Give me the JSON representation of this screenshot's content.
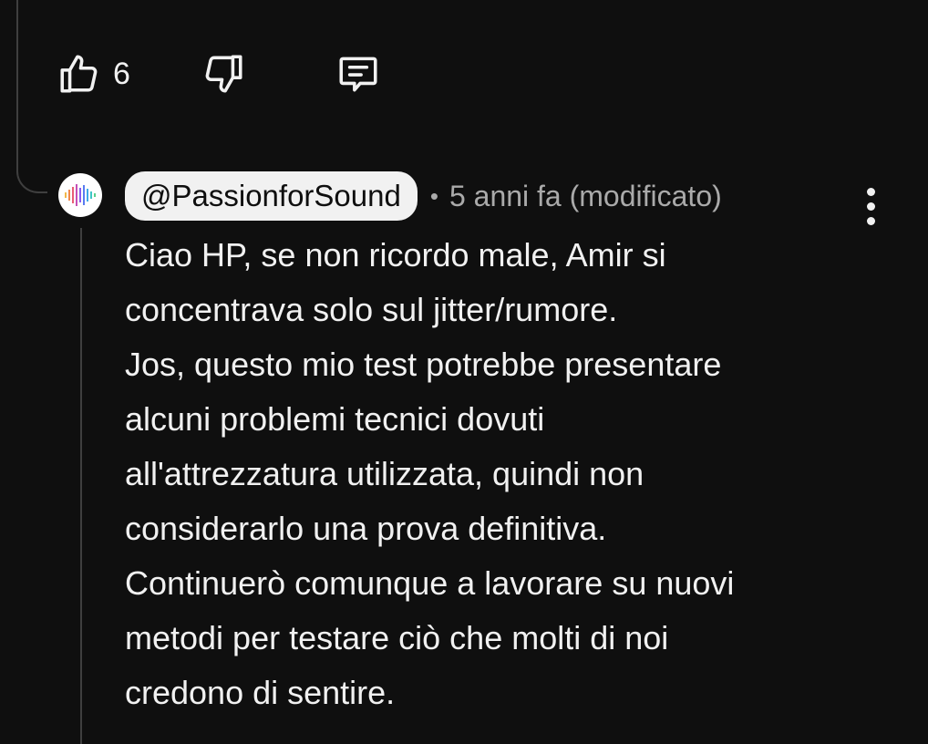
{
  "actions": {
    "like_count": "6"
  },
  "comment": {
    "author": "@PassionforSound",
    "separator": "•",
    "timestamp": "5 anni fa (modificato)",
    "lines": [
      "Ciao HP, se non ricordo male, Amir si",
      "concentrava solo sul jitter/rumore.",
      "Jos, questo mio test potrebbe presentare",
      "alcuni problemi tecnici dovuti",
      "all'attrezzatura utilizzata, quindi non",
      "considerarlo una prova definitiva.",
      "Continuerò comunque a lavorare su nuovi",
      "metodi per testare ciò che molti di noi",
      "credono di sentire."
    ]
  },
  "icons": {
    "like": "thumbs-up-icon",
    "dislike": "thumbs-down-icon",
    "reply": "comment-reply-icon",
    "more": "vertical-ellipsis-icon",
    "avatar": "sound-wave-icon"
  },
  "colors": {
    "background": "#0f0f0f",
    "text": "#f1f1f1",
    "secondary_text": "#aaaaaa",
    "thread_line": "#3f3f3f"
  }
}
